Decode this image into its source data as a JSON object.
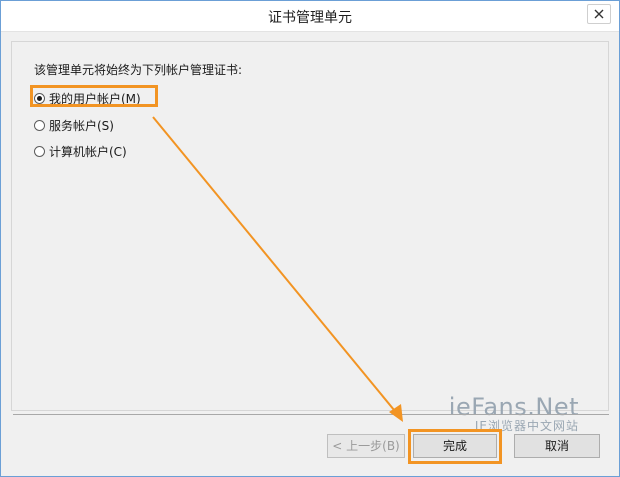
{
  "window": {
    "title": "证书管理单元"
  },
  "content": {
    "prompt": "该管理单元将始终为下列帐户管理证书:",
    "options": [
      {
        "label": "我的用户帐户(M)",
        "checked": true
      },
      {
        "label": "服务帐户(S)",
        "checked": false
      },
      {
        "label": "计算机帐户(C)",
        "checked": false
      }
    ]
  },
  "buttons": {
    "back": "< 上一步(B)",
    "finish": "完成",
    "cancel": "取消"
  },
  "watermark": {
    "main": "ieFans.Net",
    "sub": "IE浏览器中文网站"
  },
  "colors": {
    "annotation": "#f29423",
    "border": "#6b9fd6"
  }
}
